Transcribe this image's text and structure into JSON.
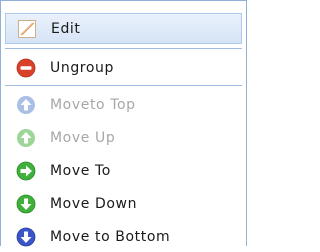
{
  "menu": {
    "items": [
      {
        "label": "Edit",
        "icon": "pencil-icon",
        "state": "selected"
      },
      {
        "label": "Ungroup",
        "icon": "minus-circle-icon",
        "state": "enabled"
      },
      {
        "label": "Moveto Top",
        "icon": "arrow-up-circle-icon",
        "state": "disabled"
      },
      {
        "label": "Move Up",
        "icon": "arrow-up-circle-icon",
        "state": "disabled"
      },
      {
        "label": "Move To",
        "icon": "arrow-right-circle-icon",
        "state": "enabled"
      },
      {
        "label": "Move Down",
        "icon": "arrow-down-circle-icon",
        "state": "enabled"
      },
      {
        "label": "Move to Bottom",
        "icon": "arrow-down-circle-icon",
        "state": "enabled"
      }
    ]
  },
  "colors": {
    "border": "#8eb0d9",
    "selected_bg": "#d6e4f6",
    "ungroup_red": "#d9412b",
    "disabled_blue": "#a9bfe6",
    "disabled_green": "#9ed69a",
    "move_green": "#3fb03a",
    "move_blue": "#3b55c9",
    "disabled_text": "#a7a7a7"
  }
}
